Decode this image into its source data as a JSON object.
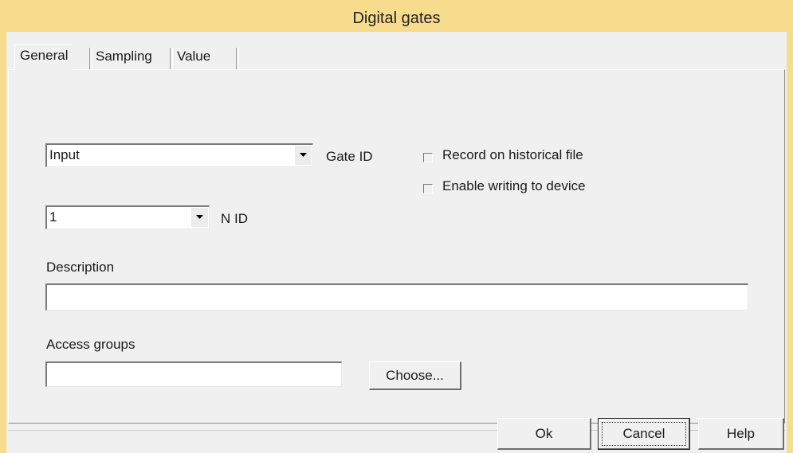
{
  "window": {
    "title": "Digital gates"
  },
  "tabs": [
    {
      "label": "General",
      "active": true
    },
    {
      "label": "Sampling",
      "active": false
    },
    {
      "label": "Value",
      "active": false
    }
  ],
  "general": {
    "gate_type": {
      "value": "Input"
    },
    "gate_id_label": "Gate ID",
    "node": {
      "value": "1"
    },
    "node_label": "N ID",
    "record_historical": {
      "label": "Record on historical file",
      "checked": false
    },
    "enable_writing": {
      "label": "Enable writing to device",
      "checked": false
    },
    "description": {
      "label": "Description",
      "value": ""
    },
    "access_groups": {
      "label": "Access groups",
      "value": ""
    },
    "choose_label": "Choose..."
  },
  "buttons": {
    "ok": "Ok",
    "cancel": "Cancel",
    "help": "Help"
  },
  "colors": {
    "titlebar": "#f7dc8e",
    "dialog_bg": "#f0f0f0"
  }
}
